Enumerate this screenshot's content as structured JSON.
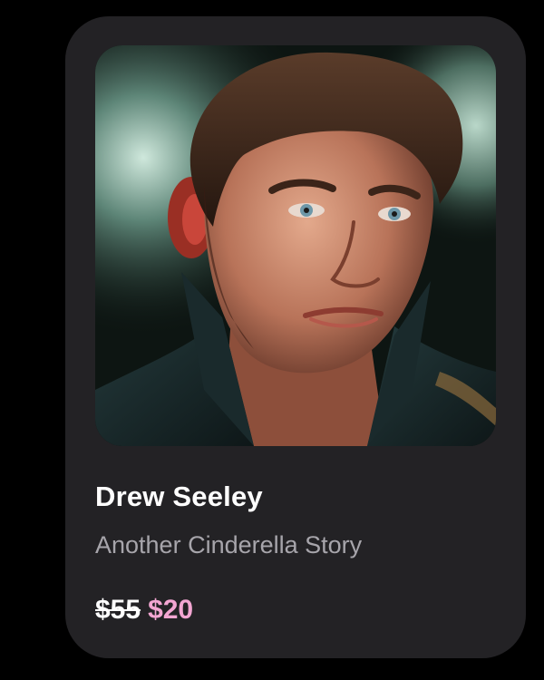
{
  "card": {
    "name": "Drew Seeley",
    "subtitle": "Another Cinderella Story",
    "price": {
      "original": "$55",
      "sale": "$20"
    }
  },
  "colors": {
    "background": "#000000",
    "card": "#232225",
    "subtitle": "#a7a5ab",
    "sale_price": "#f3a6d2"
  }
}
